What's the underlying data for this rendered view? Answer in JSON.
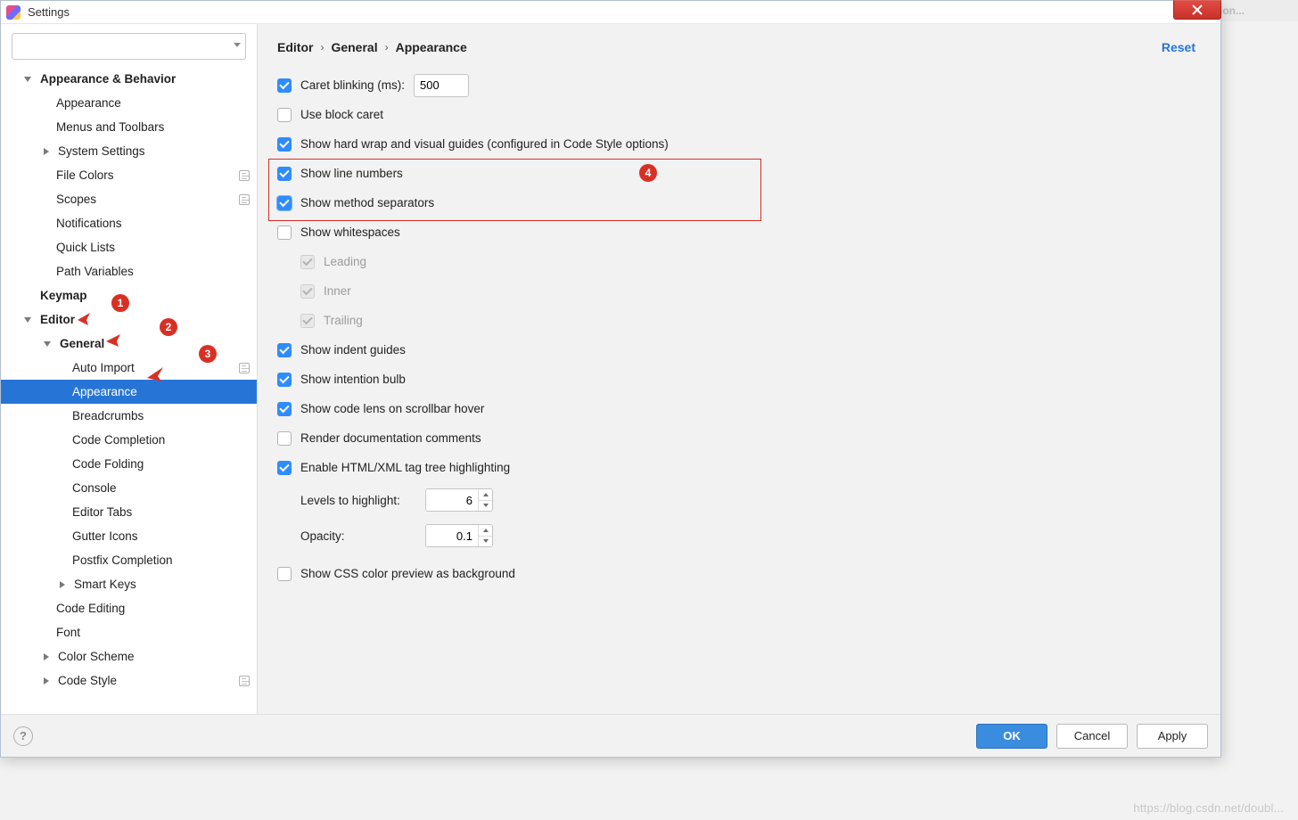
{
  "bg": {
    "add_config": "Add Configuration..."
  },
  "window": {
    "title": "Settings"
  },
  "search": {
    "placeholder": ""
  },
  "tree": [
    {
      "label": "Appearance & Behavior",
      "indent": 26,
      "bold": true,
      "arrow": "down"
    },
    {
      "label": "Appearance",
      "indent": 62
    },
    {
      "label": "Menus and Toolbars",
      "indent": 62
    },
    {
      "label": "System Settings",
      "indent": 48,
      "arrow": "right",
      "indent_arrow": true
    },
    {
      "label": "File Colors",
      "indent": 62,
      "proj": true
    },
    {
      "label": "Scopes",
      "indent": 62,
      "proj": true
    },
    {
      "label": "Notifications",
      "indent": 62
    },
    {
      "label": "Quick Lists",
      "indent": 62
    },
    {
      "label": "Path Variables",
      "indent": 62
    },
    {
      "label": "Keymap",
      "indent": 44,
      "bold": true
    },
    {
      "label": "Editor",
      "indent": 26,
      "bold": true,
      "arrow": "down"
    },
    {
      "label": "General",
      "indent": 48,
      "bold": true,
      "arrow": "down",
      "indent_arrow": true
    },
    {
      "label": "Auto Import",
      "indent": 80,
      "proj": true
    },
    {
      "label": "Appearance",
      "indent": 80,
      "selected": true
    },
    {
      "label": "Breadcrumbs",
      "indent": 80
    },
    {
      "label": "Code Completion",
      "indent": 80
    },
    {
      "label": "Code Folding",
      "indent": 80
    },
    {
      "label": "Console",
      "indent": 80
    },
    {
      "label": "Editor Tabs",
      "indent": 80
    },
    {
      "label": "Gutter Icons",
      "indent": 80
    },
    {
      "label": "Postfix Completion",
      "indent": 80
    },
    {
      "label": "Smart Keys",
      "indent": 66,
      "arrow": "right",
      "indent_arrow": true
    },
    {
      "label": "Code Editing",
      "indent": 62
    },
    {
      "label": "Font",
      "indent": 62
    },
    {
      "label": "Color Scheme",
      "indent": 48,
      "arrow": "right",
      "indent_arrow": true
    },
    {
      "label": "Code Style",
      "indent": 48,
      "arrow": "right",
      "indent_arrow": true,
      "proj": true
    }
  ],
  "breadcrumb": {
    "a": "Editor",
    "b": "General",
    "c": "Appearance",
    "reset": "Reset"
  },
  "opts": {
    "caret_blinking_label": "Caret blinking (ms):",
    "caret_blinking_value": "500",
    "use_block_caret": "Use block caret",
    "show_hard_wrap": "Show hard wrap and visual guides (configured in Code Style options)",
    "show_line_numbers": "Show line numbers",
    "show_method_sep": "Show method separators",
    "show_whitespaces": "Show whitespaces",
    "leading": "Leading",
    "inner": "Inner",
    "trailing": "Trailing",
    "show_indent_guides": "Show indent guides",
    "show_intention_bulb": "Show intention bulb",
    "show_code_lens": "Show code lens on scrollbar hover",
    "render_doc": "Render documentation comments",
    "enable_tag_tree": "Enable HTML/XML tag tree highlighting",
    "levels_label": "Levels to highlight:",
    "levels_value": "6",
    "opacity_label": "Opacity:",
    "opacity_value": "0.1",
    "show_css_color": "Show CSS color preview as background"
  },
  "callouts": {
    "c1": "1",
    "c2": "2",
    "c3": "3",
    "c4": "4"
  },
  "footer": {
    "ok": "OK",
    "cancel": "Cancel",
    "apply": "Apply",
    "help": "?"
  },
  "watermark": "https://blog.csdn.net/doubl..."
}
